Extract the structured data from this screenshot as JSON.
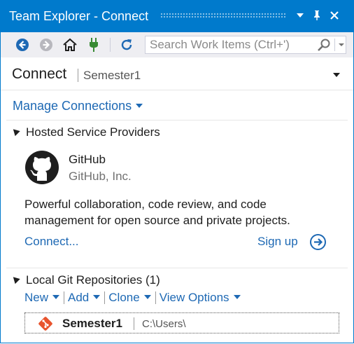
{
  "window": {
    "title": "Team Explorer - Connect",
    "dropdown_icon": "chevron-down-icon",
    "pin_icon": "pin-icon",
    "close_icon": "close-icon"
  },
  "toolbar": {
    "buttons": [
      "back-icon",
      "forward-icon",
      "home-icon",
      "plug-icon",
      "refresh-icon"
    ],
    "search": {
      "placeholder": "Search Work Items (Ctrl+')"
    }
  },
  "header": {
    "title": "Connect",
    "subtitle": "Semester1"
  },
  "manage_connections": "Manage Connections",
  "hosted": {
    "heading": "Hosted Service Providers",
    "provider": {
      "name": "GitHub",
      "company": "GitHub, Inc.",
      "description": "Powerful collaboration, code review, and code management for open source and private projects.",
      "connect_label": "Connect...",
      "signup_label": "Sign up"
    }
  },
  "local": {
    "heading": "Local Git Repositories (1)",
    "actions": [
      "New",
      "Add",
      "Clone",
      "View Options"
    ],
    "repos": [
      {
        "name": "Semester1",
        "path": "C:\\Users\\"
      }
    ]
  },
  "colors": {
    "accent": "#007acc",
    "link": "#1e69b4",
    "git_icon": "#e8542e"
  }
}
